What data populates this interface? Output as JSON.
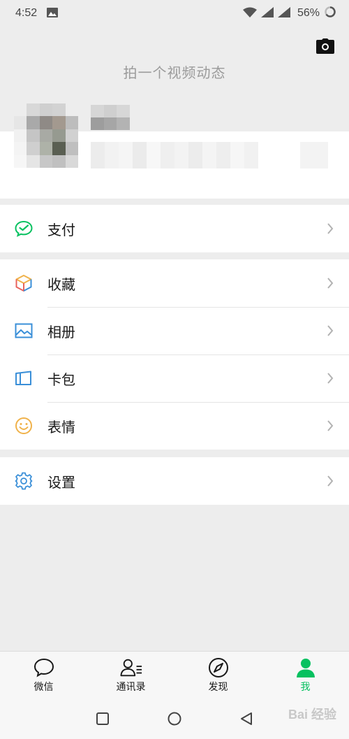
{
  "status_bar": {
    "time": "4:52",
    "battery": "56%"
  },
  "header": {
    "video_prompt": "拍一个视频动态"
  },
  "menu_groups": [
    {
      "items": [
        {
          "label": "支付",
          "icon": "wechat-pay-icon"
        }
      ]
    },
    {
      "items": [
        {
          "label": "收藏",
          "icon": "favorites-cube-icon"
        },
        {
          "label": "相册",
          "icon": "album-icon"
        },
        {
          "label": "卡包",
          "icon": "card-wallet-icon"
        },
        {
          "label": "表情",
          "icon": "sticker-smile-icon"
        }
      ]
    },
    {
      "items": [
        {
          "label": "设置",
          "icon": "settings-gear-icon"
        }
      ]
    }
  ],
  "tab_bar": {
    "tabs": [
      {
        "label": "微信",
        "icon": "chat-bubble-icon",
        "active": false
      },
      {
        "label": "通讯录",
        "icon": "contacts-icon",
        "active": false
      },
      {
        "label": "发现",
        "icon": "compass-icon",
        "active": false
      },
      {
        "label": "我",
        "icon": "person-icon",
        "active": true
      }
    ]
  },
  "watermark": "Bai 经验",
  "colors": {
    "accent_green": "#07c160",
    "background": "#ededed",
    "card": "#ffffff"
  }
}
